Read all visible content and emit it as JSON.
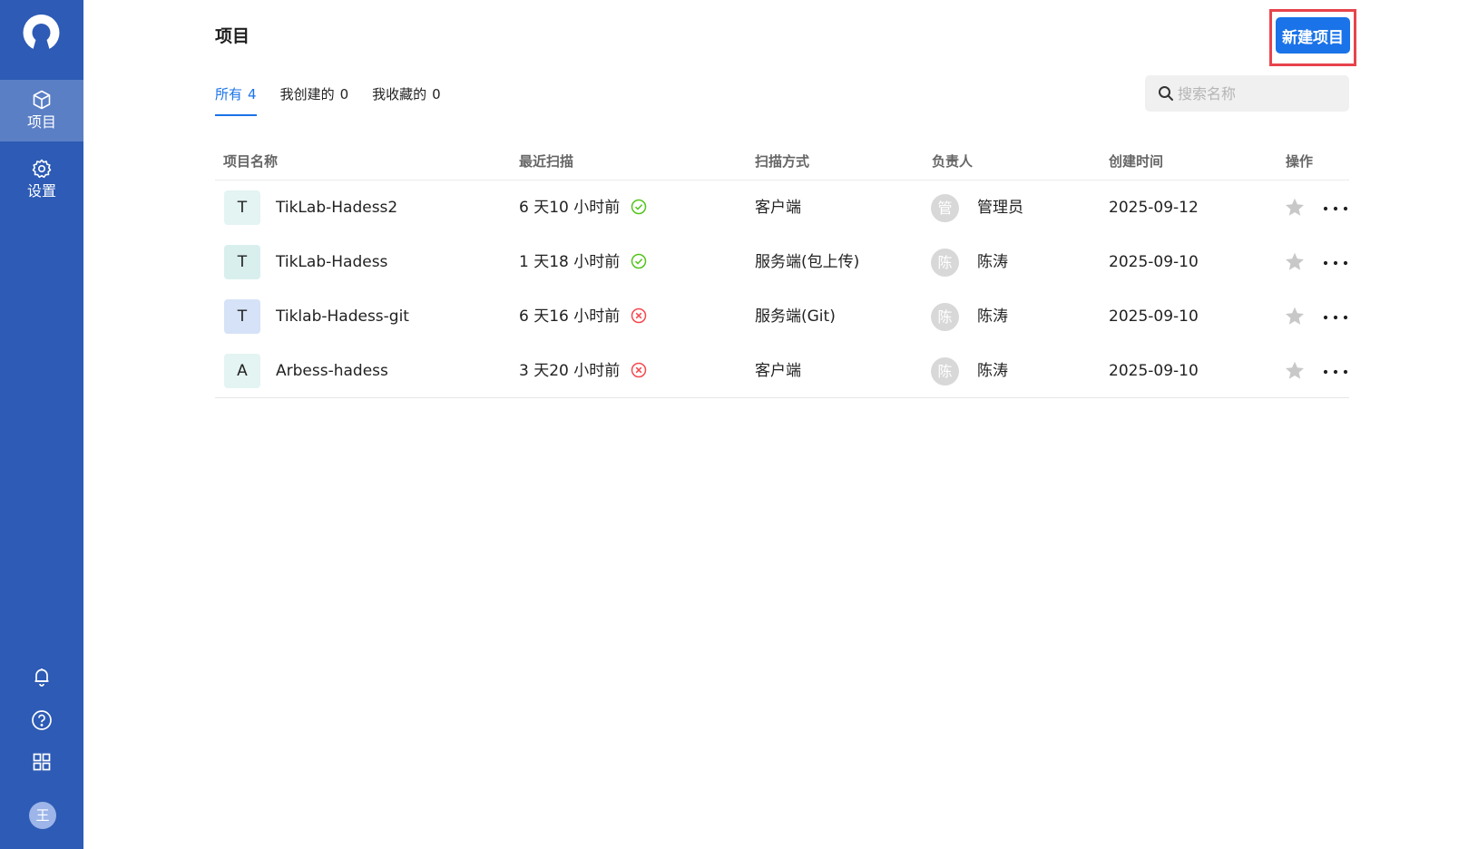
{
  "sidebar": {
    "nav": [
      {
        "label": "项目",
        "icon": "cube-icon",
        "active": true
      },
      {
        "label": "设置",
        "icon": "gear-icon",
        "active": false
      }
    ],
    "bottom_icons": [
      "bell-icon",
      "help-icon",
      "apps-grid-icon"
    ],
    "avatar_text": "王"
  },
  "header": {
    "title": "项目",
    "new_button": "新建项目"
  },
  "tabs": [
    {
      "label": "所有",
      "count": "4",
      "active": true
    },
    {
      "label": "我创建的",
      "count": "0",
      "active": false
    },
    {
      "label": "我收藏的",
      "count": "0",
      "active": false
    }
  ],
  "search": {
    "placeholder": "搜索名称"
  },
  "table": {
    "columns": [
      "项目名称",
      "最近扫描",
      "扫描方式",
      "负责人",
      "创建时间",
      "操作"
    ],
    "rows": [
      {
        "avatar": "T",
        "avatar_color": "#e3f4f2",
        "name": "TikLab-Hadess2",
        "last_scan": "6 天10 小时前",
        "scan_status": "success",
        "scan_mode": "客户端",
        "owner_avatar": "管",
        "owner": "管理员",
        "created": "2025-09-12"
      },
      {
        "avatar": "T",
        "avatar_color": "#d9efee",
        "name": "TikLab-Hadess",
        "last_scan": "1 天18 小时前",
        "scan_status": "success",
        "scan_mode": "服务端(包上传)",
        "owner_avatar": "陈",
        "owner": "陈涛",
        "created": "2025-09-10"
      },
      {
        "avatar": "T",
        "avatar_color": "#d6e2f7",
        "name": "Tiklab-Hadess-git",
        "last_scan": "6 天16 小时前",
        "scan_status": "failed",
        "scan_mode": "服务端(Git)",
        "owner_avatar": "陈",
        "owner": "陈涛",
        "created": "2025-09-10"
      },
      {
        "avatar": "A",
        "avatar_color": "#e3f4f2",
        "name": "Arbess-hadess",
        "last_scan": "3 天20 小时前",
        "scan_status": "failed",
        "scan_mode": "客户端",
        "owner_avatar": "陈",
        "owner": "陈涛",
        "created": "2025-09-10"
      }
    ]
  },
  "colors": {
    "sidebar": "#2d5bb5",
    "primary": "#1a73e8",
    "success": "#52c41a",
    "error": "#f5484f",
    "highlight_frame": "#e8434c"
  }
}
